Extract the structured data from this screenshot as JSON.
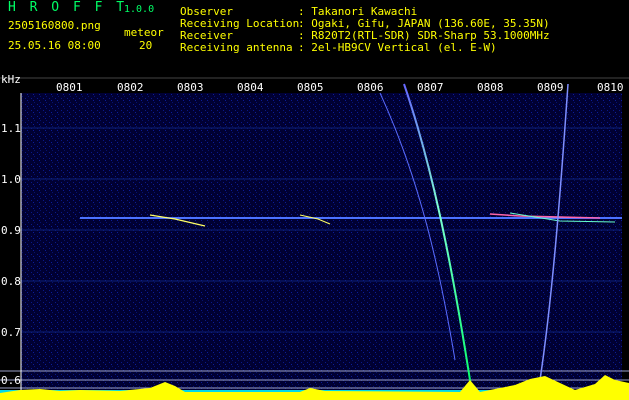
{
  "app": {
    "name": "H R O F F T",
    "version": "1.0.0"
  },
  "file": {
    "name": "2505160800.png",
    "datetime": "25.05.16 08:00"
  },
  "meteor": {
    "label": "meteor",
    "count": "20"
  },
  "info": {
    "observer_label": "Observer",
    "observer_value": ": Takanori Kawachi",
    "location_label": "Receiving Location",
    "location_value": ": Ogaki, Gifu, JAPAN (136.60E, 35.35N)",
    "receiver_label": "Receiver",
    "receiver_value": ": R820T2(RTL-SDR) SDR-Sharp 53.1000MHz",
    "antenna_label": "Receiving antenna",
    "antenna_value": ": 2el-HB9CV Vertical (el. E-W)"
  },
  "axis": {
    "unit": "kHz",
    "x_ticks": [
      "0801",
      "0802",
      "0803",
      "0804",
      "0805",
      "0806",
      "0807",
      "0808",
      "0809",
      "0810"
    ],
    "y_ticks": [
      "1.1",
      "1.0",
      "0.9",
      "0.8",
      "0.7",
      "0.6"
    ]
  },
  "colors": {
    "header_text": "#ffff00",
    "label_text": "#ffffff",
    "signal": "#ffff00",
    "noise": "#00ffff",
    "background": "#000033"
  }
}
